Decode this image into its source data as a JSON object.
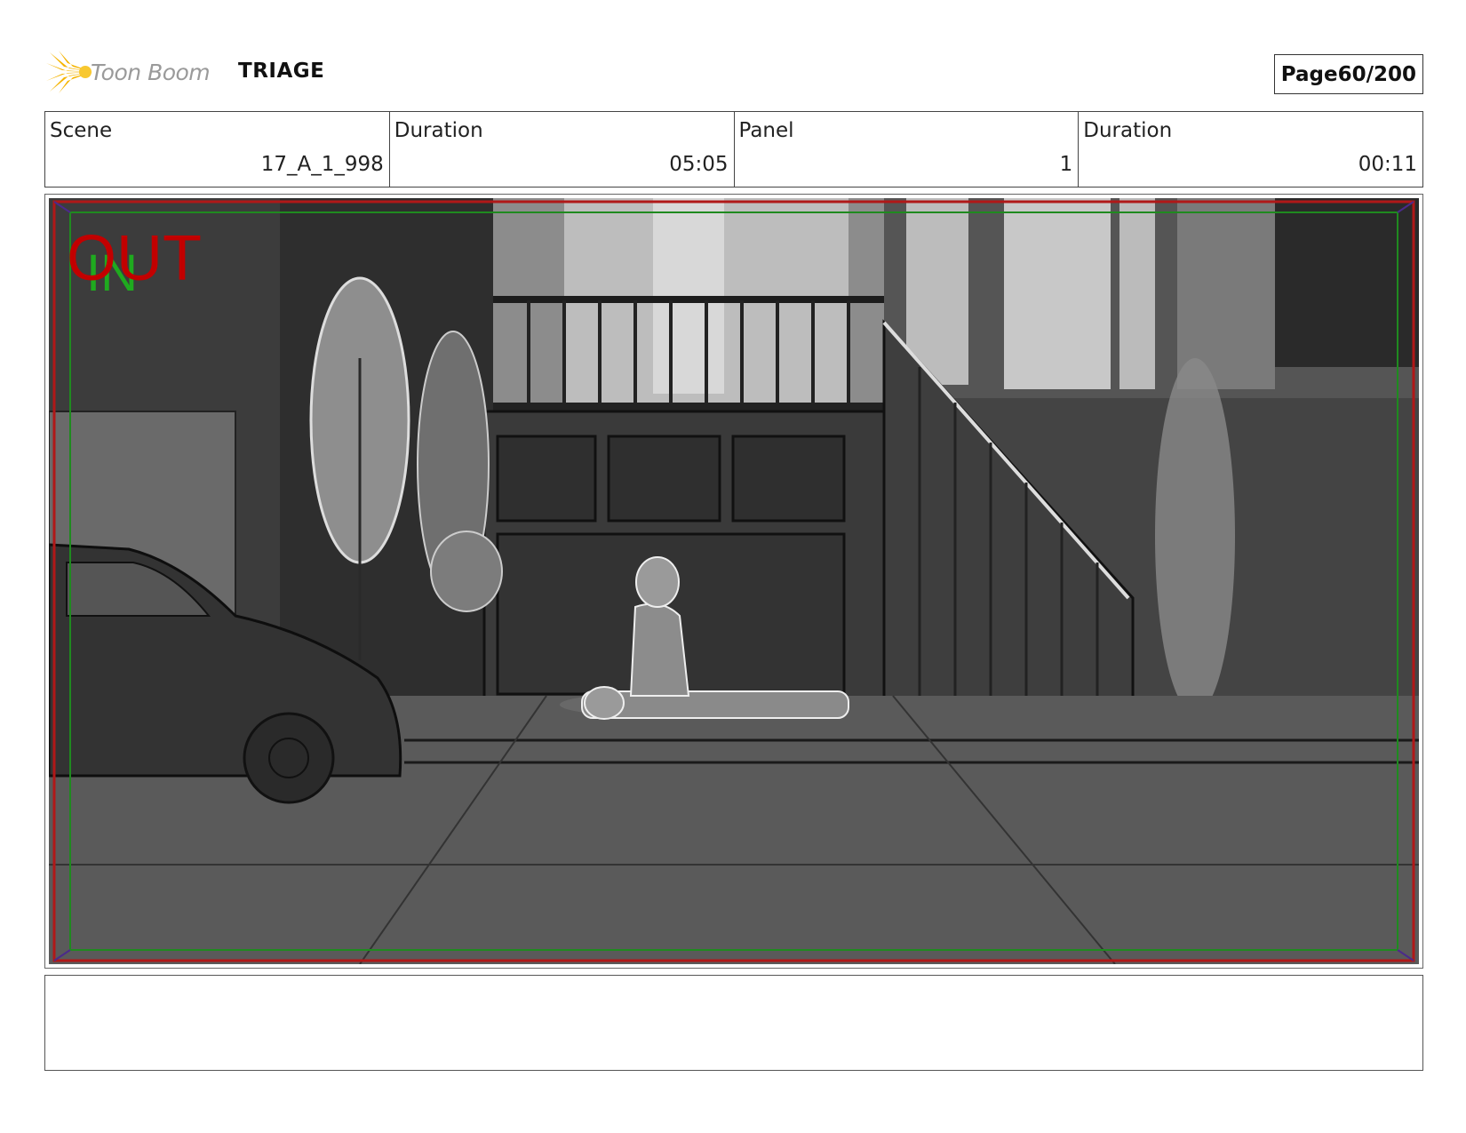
{
  "header": {
    "brand": "Toon Boom",
    "project": "TRIAGE",
    "page_label": "Page",
    "page_value": "60/200"
  },
  "info": {
    "scene_label": "Scene",
    "scene_value": "17_A_1_998",
    "duration_label": "Duration",
    "duration_value": "05:05",
    "panel_label": "Panel",
    "panel_value": "1",
    "panel_duration_label": "Duration",
    "panel_duration_value": "00:11"
  },
  "panel": {
    "out_tag": "OUT",
    "in_tag": "IN"
  },
  "colors": {
    "safe_frame_red": "#b01818",
    "title_safe_green": "#1f8a1f",
    "logo_yellow": "#f5b400"
  },
  "notes": ""
}
